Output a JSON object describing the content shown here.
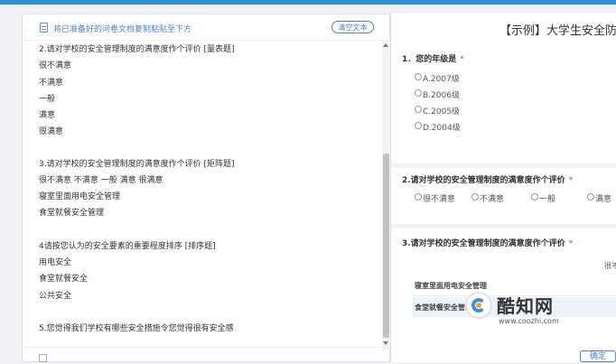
{
  "editor": {
    "hint": "将已准备好的问卷文档复制粘贴至下方",
    "clear_button": "清空文本",
    "lines": [
      "2.请对学校的安全管理制度的满意度作个评价 [量表题]",
      "很不满意",
      "不满意",
      "一般",
      "满意",
      "很满意",
      "",
      " 3.请对学校的安全管理制度的满意度作个评价 [矩阵题]",
      "很不满意 不满意 一般 满意 很满意",
      "寝室里面用电安全管理",
      "食堂就餐安全管理",
      "",
      "4请按您认为的安全要素的重要程度排序 [排序题]",
      "用电安全",
      "食堂就餐安全",
      "公共安全",
      "",
      "5.您觉得我们学校有哪些安全措施令您觉得很有安全感"
    ]
  },
  "preview": {
    "title": "【示例】大学生安全防范",
    "required_mark": "*",
    "q1": {
      "title": "1．您的年级是",
      "options": [
        "A.2007级",
        "B.2006级",
        "C.2005级",
        "D.2004级"
      ]
    },
    "q2": {
      "title": "2.请对学校的安全管理制度的满意度作个评价",
      "options": [
        "很不满意",
        "不满意",
        "一般",
        "满意"
      ]
    },
    "q3": {
      "title": "3.请对学校的安全管理制度的满意度作个评价",
      "column_label": "很不",
      "rows": [
        "寝室里面用电安全管理",
        "食堂就餐安全管理"
      ]
    }
  },
  "watermark": {
    "name": "酷知网",
    "url": "www.coozhi.com"
  },
  "confirm_button": "确定"
}
